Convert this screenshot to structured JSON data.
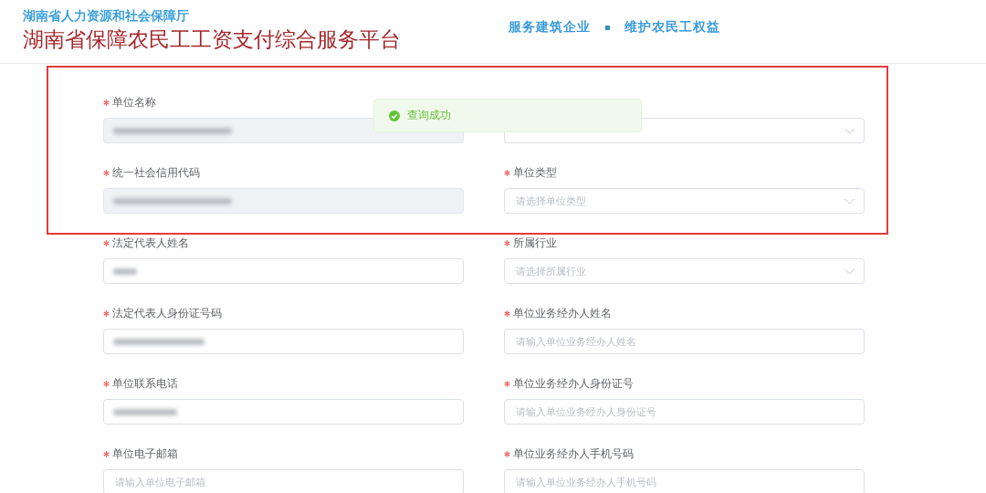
{
  "header": {
    "department": "湖南省人力资源和社会保障厅",
    "platform": "湖南省保障农民工工资支付综合服务平台",
    "slogans": [
      "服务建筑企业",
      "维护农民工权益"
    ]
  },
  "highlight_frame": true,
  "toast": {
    "kind": "success",
    "message": "查询成功"
  },
  "fields": [
    {
      "label": "单位名称",
      "required": true,
      "kind": "input",
      "disabled": true,
      "value_hidden": true
    },
    {
      "kind": "select",
      "disabled": false
    },
    {
      "label": "统一社会信用代码",
      "required": true,
      "kind": "input",
      "disabled": true,
      "value_hidden": true
    },
    {
      "label": "单位类型",
      "required": true,
      "kind": "select",
      "disabled": false,
      "placeholder": "请选择单位类型"
    },
    {
      "label": "法定代表人姓名",
      "required": true,
      "kind": "input",
      "disabled": false,
      "value_hidden": true
    },
    {
      "label": "所属行业",
      "required": true,
      "kind": "select",
      "disabled": false,
      "placeholder": "请选择所属行业"
    },
    {
      "label": "法定代表人身份证号码",
      "required": true,
      "kind": "input",
      "disabled": false,
      "value_hidden": true
    },
    {
      "label": "单位业务经办人姓名",
      "required": true,
      "kind": "input",
      "disabled": false,
      "placeholder": "请输入单位业务经办人姓名"
    },
    {
      "label": "单位联系电话",
      "required": true,
      "kind": "input",
      "disabled": false,
      "value_hidden": true
    },
    {
      "label": "单位业务经办人身份证号",
      "required": true,
      "kind": "input",
      "disabled": false,
      "placeholder": "请输入单位业务经办人身份证号"
    },
    {
      "label": "单位电子邮箱",
      "required": true,
      "kind": "input",
      "disabled": false,
      "placeholder": "请输入单位电子邮箱"
    },
    {
      "label": "单位业务经办人手机号码",
      "required": true,
      "kind": "input",
      "disabled": false,
      "placeholder": "请输入单位业务经办人手机号码"
    }
  ]
}
